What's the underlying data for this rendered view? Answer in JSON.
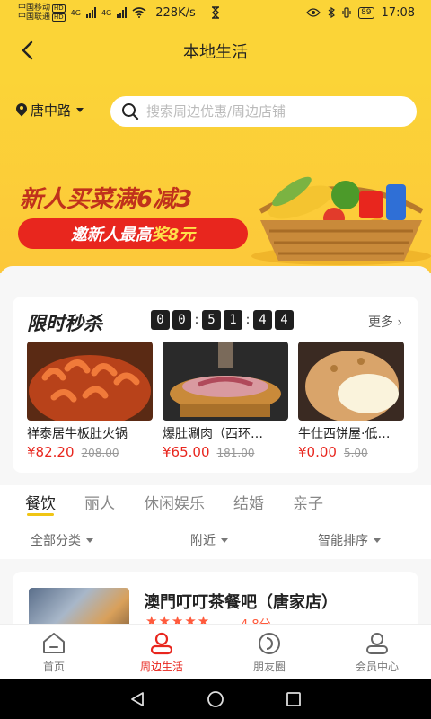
{
  "status_bar": {
    "carrier1": "中国移动",
    "carrier2": "中国联通",
    "hd": "HD",
    "net1": "4G",
    "net2": "4G",
    "speed": "228K/s",
    "battery": "89",
    "time": "17:08"
  },
  "nav": {
    "title": "本地生活"
  },
  "location": {
    "label": "唐中路"
  },
  "search": {
    "placeholder": "搜索周边优惠/周边店铺"
  },
  "banner": {
    "title": "新人买菜满6减3",
    "pill_prefix": "邀新人最高",
    "pill_accent": "奖8元"
  },
  "flash_sale": {
    "title": "限时秒杀",
    "countdown": [
      "0",
      "0",
      "5",
      "1",
      "4",
      "4"
    ],
    "more": "更多",
    "products": [
      {
        "name": "祥泰居牛板肚火锅",
        "price": "¥82.20",
        "old_price": "208.00"
      },
      {
        "name": "爆肚涮肉（西环…",
        "price": "¥65.00",
        "old_price": "181.00"
      },
      {
        "name": "牛仕西饼屋·低…",
        "price": "¥0.00",
        "old_price": "5.00"
      }
    ]
  },
  "categories": [
    "餐饮",
    "丽人",
    "休闲娱乐",
    "结婚",
    "亲子"
  ],
  "filters": [
    "全部分类",
    "附近",
    "智能排序"
  ],
  "shop": {
    "name": "澳門叮叮茶餐吧（唐家店）",
    "stars": "★★★★★",
    "score": "4.8分"
  },
  "bottom_nav": [
    {
      "label": "首页",
      "icon": "home-icon"
    },
    {
      "label": "周边生活",
      "icon": "person-icon"
    },
    {
      "label": "朋友圈",
      "icon": "moments-icon"
    },
    {
      "label": "会员中心",
      "icon": "member-icon"
    }
  ],
  "colors": {
    "theme": "#fbd437",
    "accent": "#e8261e"
  }
}
